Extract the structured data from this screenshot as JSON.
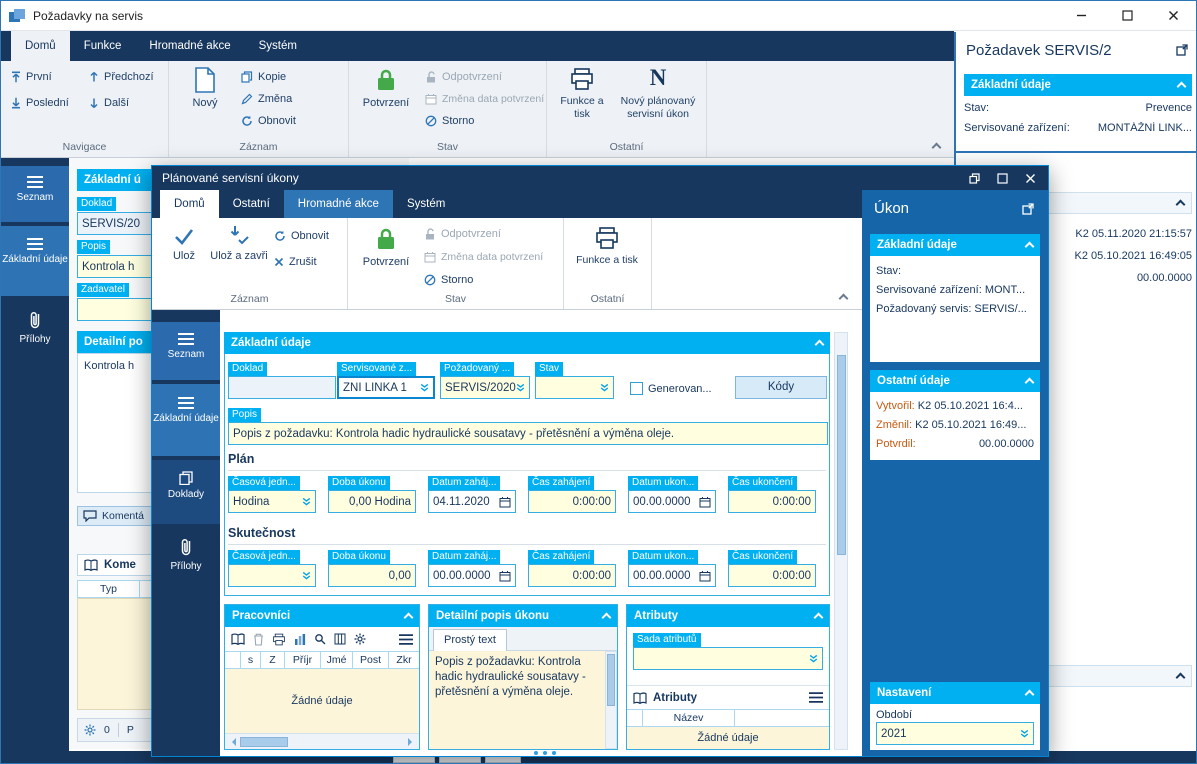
{
  "main": {
    "title": "Požadavky na servis",
    "tabs": [
      {
        "label": "Domů"
      },
      {
        "label": "Funkce"
      },
      {
        "label": "Hromadné akce"
      },
      {
        "label": "Systém"
      }
    ],
    "ribbon": {
      "navigace": {
        "label": "Navigace",
        "prvni": "První",
        "predchozi": "Předchozí",
        "posledni": "Poslední",
        "dalsi": "Další"
      },
      "zaznam": {
        "label": "Záznam",
        "novy": "Nový",
        "kopie": "Kopie",
        "zmena": "Změna",
        "obnovit": "Obnovit"
      },
      "stav": {
        "label": "Stav",
        "potvrzeni": "Potvrzení",
        "odpotvrzeni": "Odpotvrzení",
        "zmena_data": "Změna data potvrzení",
        "storno": "Storno"
      },
      "ostatni": {
        "label": "Ostatní",
        "funkce_tisk": "Funkce a tisk",
        "novy_ukon": "Nový plánovaný servisní úkon"
      }
    },
    "sidebar": {
      "seznam": "Seznam",
      "zakladni": "Základní údaje",
      "prilohy": "Přílohy"
    },
    "left": {
      "header": "Základní ú",
      "doklad_label": "Doklad",
      "doklad_value": "SERVIS/20",
      "popis_label": "Popis",
      "popis_value": "Kontrola h",
      "zadavatel_label": "Zadavatel",
      "detail_header": "Detailní po",
      "detail_text": "Kontrola h",
      "koment_bar": "Komentá",
      "kome_header": "Kome",
      "typ_col": "Typ",
      "count": "0",
      "p_label": "P"
    },
    "right": {
      "title": "Požadavek SERVIS/2",
      "zakladni_header": "Základní údaje",
      "stav_label": "Stav:",
      "stav_value": "Prevence",
      "zarizeni_label": "Servisované zařízení:",
      "zarizeni_value": "MONTÁŽNÍ LINK...",
      "log": [
        "K2 05.11.2020 21:15:57",
        "K2 05.10.2021 16:49:05",
        "00.00.0000"
      ]
    }
  },
  "dialog": {
    "title": "Plánované servisní úkony",
    "tabs": [
      {
        "label": "Domů"
      },
      {
        "label": "Ostatní"
      },
      {
        "label": "Hromadné akce"
      },
      {
        "label": "Systém"
      }
    ],
    "ribbon": {
      "uloz": "Ulož",
      "uloz_zavri": "Ulož a zavři",
      "obnovit": "Obnovit",
      "zrusit": "Zrušit",
      "zaznam_label": "Záznam",
      "potvrzeni": "Potvrzení",
      "odpotvrzeni": "Odpotvrzení",
      "zmena_data": "Změna data potvrzení",
      "storno": "Storno",
      "stav_label": "Stav",
      "funkce_tisk": "Funkce a tisk",
      "ostatni_label": "Ostatní"
    },
    "sidebar": {
      "seznam": "Seznam",
      "zakladni": "Základní údaje",
      "doklady": "Doklady",
      "prilohy": "Přílohy"
    },
    "form": {
      "header": "Základní údaje",
      "doklad_label": "Doklad",
      "serv_label": "Servisované z...",
      "serv_value": "ŽNÍ LINKA 1",
      "pozad_label": "Požadovaný ...",
      "pozad_value": "SERVIS/2020",
      "stav_label": "Stav",
      "generovan_label": "Generovan...",
      "kody_button": "Kódy",
      "popis_label": "Popis",
      "popis_value": "Popis z požadavku: Kontrola hadic hydraulické sousatavy - přetěsnění a výměna oleje.",
      "plan_title": "Plán",
      "skutecnost_title": "Skutečnost",
      "plan_fields": [
        {
          "label": "Časová jedn...",
          "value": "Hodina"
        },
        {
          "label": "Doba úkonu",
          "value": "0,00 Hodina"
        },
        {
          "label": "Datum zaháj...",
          "value": "04.11.2020"
        },
        {
          "label": "Čas zahájení",
          "value": "0:00:00"
        },
        {
          "label": "Datum ukon...",
          "value": "00.00.0000"
        },
        {
          "label": "Čas ukončení",
          "value": "0:00:00"
        }
      ],
      "skut_fields": [
        {
          "label": "Časová jedn...",
          "value": ""
        },
        {
          "label": "Doba úkonu",
          "value": "0,00"
        },
        {
          "label": "Datum zaháj...",
          "value": "00.00.0000"
        },
        {
          "label": "Čas zahájení",
          "value": "0:00:00"
        },
        {
          "label": "Datum ukon...",
          "value": "00.00.0000"
        },
        {
          "label": "Čas ukončení",
          "value": "0:00:00"
        }
      ]
    },
    "pracovnici": {
      "header": "Pracovníci",
      "columns": [
        "s",
        "Z",
        "Příjr",
        "Jmé",
        "Post",
        "Zkr"
      ],
      "empty": "Žádné údaje"
    },
    "detail": {
      "header": "Detailní popis úkonu",
      "tab": "Prostý text",
      "text": "Popis z požadavku: Kontrola hadic hydraulické sousatavy - přetěsnění a výměna oleje."
    },
    "atributy": {
      "header": "Atributy",
      "sada_label": "Sada atributů",
      "sub_header": "Atributy",
      "column": "Název",
      "empty": "Žádné údaje"
    },
    "ukon": {
      "title": "Úkon",
      "zakladni_header": "Základní údaje",
      "rows": [
        "Stav:",
        "Servisované zařízení: MONT...",
        "Požadovaný servis: SERVIS/..."
      ],
      "ostatni_header": "Ostatní údaje",
      "vytvoril_label": "Vytvořil:",
      "vytvoril_value": "K2 05.10.2021 16:4...",
      "zmenil_label": "Změnil:",
      "zmenil_value": "K2 05.10.2021 16:49...",
      "potvrdil_label": "Potvrdil:",
      "potvrdil_value": "00.00.0000",
      "nastaveni_header": "Nastavení",
      "obdobi_label": "Období",
      "obdobi_value": "2021"
    }
  }
}
